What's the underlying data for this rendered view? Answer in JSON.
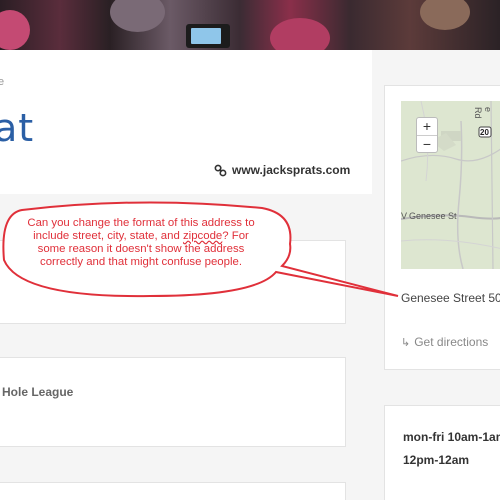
{
  "breadcrumb": "e",
  "title": "at",
  "website": "www.jacksprats.com",
  "league": "Hole League",
  "map": {
    "zoom_in": "+",
    "zoom_out": "−",
    "road_label": "Genesee St",
    "road_prefix": "V",
    "route_badge": "20",
    "road_label_2": "e Rd"
  },
  "address": "Genesee Street 50",
  "directions": "Get directions",
  "hours": {
    "line1": "mon-fri 10am-1am",
    "line2": "12pm-12am"
  },
  "callout": {
    "line1": "Can you change the format of this address to",
    "line2_pre": "include street, city, state, and ",
    "line2_mark": "zipcode",
    "line2_post": "? For",
    "line3": "some reason it doesn't show the address",
    "line4": "correctly and that might confuse people.",
    "color": "#e0303a"
  },
  "colors": {
    "accent": "#2b5fa5",
    "annotation": "#e0303a"
  }
}
